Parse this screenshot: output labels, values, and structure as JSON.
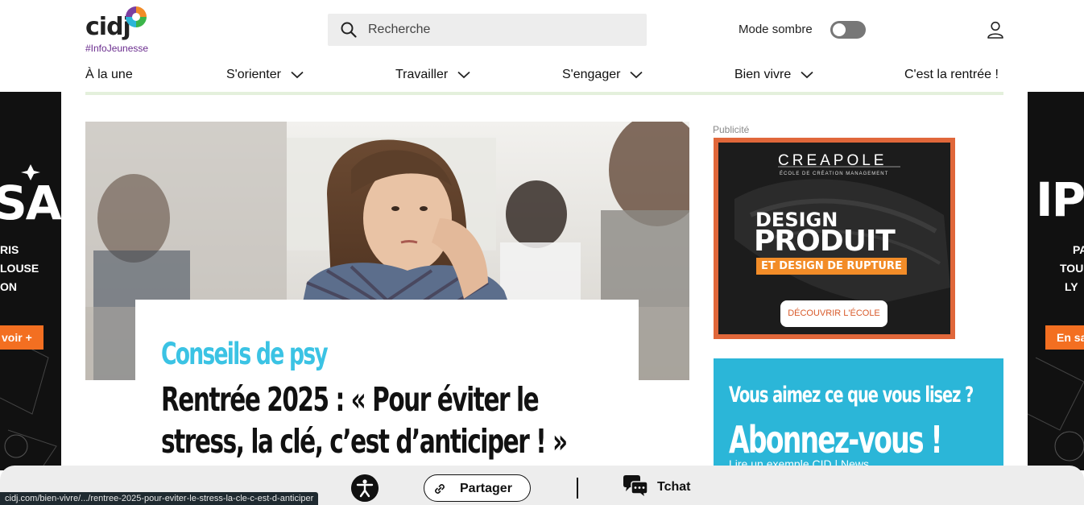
{
  "logo": {
    "text": "cidj",
    "tagline": "#InfoJeunesse"
  },
  "search": {
    "placeholder": "Recherche"
  },
  "header": {
    "dark_mode_label": "Mode sombre",
    "dark_mode_on": false
  },
  "nav": {
    "items": [
      {
        "label": "À la une",
        "has_dropdown": false
      },
      {
        "label": "S'orienter",
        "has_dropdown": true
      },
      {
        "label": "Travailler",
        "has_dropdown": true
      },
      {
        "label": "S'engager",
        "has_dropdown": true
      },
      {
        "label": "Bien vivre",
        "has_dropdown": true
      },
      {
        "label": "C'est la rentrée !",
        "has_dropdown": false
      }
    ]
  },
  "side_ad_left": {
    "logo_text": "SA",
    "lines": [
      "RIS",
      "LOUSE",
      "ON"
    ],
    "button": "voir +"
  },
  "side_ad_right": {
    "logo_text": "IPS",
    "lines": [
      "PA",
      "TOU",
      "LY"
    ],
    "button": "En sa"
  },
  "article": {
    "category": "Conseils de psy",
    "title": "Rentrée 2025 : « Pour éviter le stress, la clé, c’est d’anticiper ! »"
  },
  "ad": {
    "label": "Publicité",
    "brand": "CREAPOLE",
    "brand_sub": "ÉCOLE DE CRÉATION MANAGEMENT",
    "headline_1": "DESIGN",
    "headline_2": "PRODUIT",
    "headline_3": "ET DESIGN DE RUPTURE",
    "button": "DÉCOUVRIR L'ÉCOLE"
  },
  "subscribe": {
    "question": "Vous aimez ce que vous lisez ?",
    "cta": "Abonnez-vous !",
    "link": "Lire un exemple CID | News"
  },
  "bottom_bar": {
    "share_label": "Partager",
    "chat_label": "Tchat"
  },
  "status_url": "cidj.com/bien-vivre/.../rentree-2025-pour-eviter-le-stress-la-cle-c-est-d-anticiper",
  "colors": {
    "accent_cyan": "#3bc3e4",
    "subscribe_bg": "#2bb6d8",
    "brand_purple": "#6a2c8e",
    "ad_orange": "#f28c28"
  }
}
